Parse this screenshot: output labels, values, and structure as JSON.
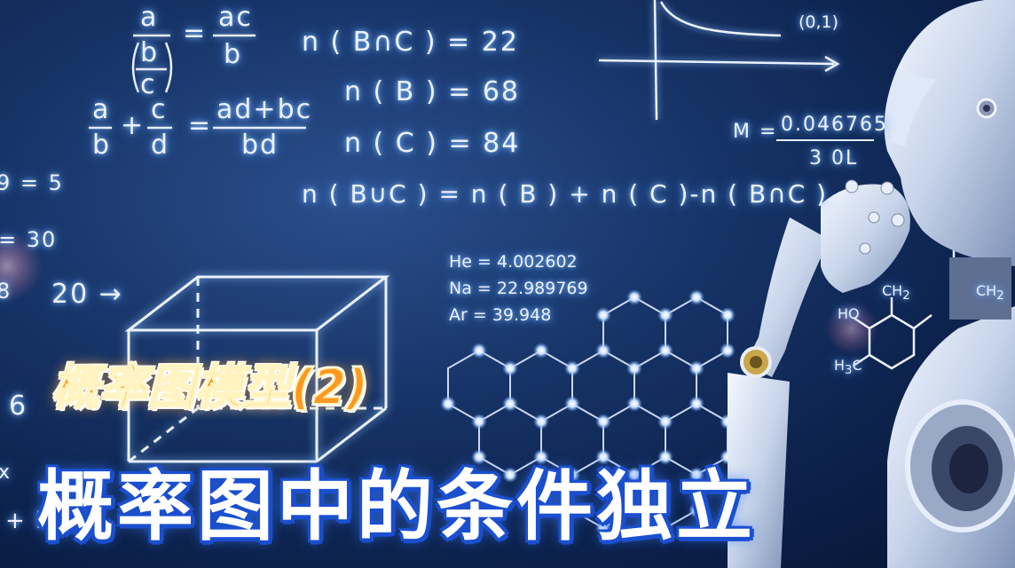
{
  "formulas": {
    "frac_nested_num": "a",
    "frac_nested_den_b": "b",
    "frac_nested_den_c": "c",
    "frac_eq": "=",
    "frac_result_num": "ac",
    "frac_result_den": "b",
    "add_a": "a",
    "add_b": "b",
    "add_plus": "+",
    "add_c": "c",
    "add_d": "d",
    "add_eq": "=",
    "add_result_num": "ad+bc",
    "add_result_den": "bd",
    "n_bc": "n ( B∩C ) = 22",
    "n_b": "n ( B ) = 68",
    "n_c": "n ( C ) = 84",
    "n_union": "n ( B∪C ) = n ( B ) + n ( C )-n ( B∩C )",
    "left_eq1": "9 = 5",
    "left_eq2": "= 30",
    "left_8": "8",
    "arrow_20": "20 →",
    "left_6": "6",
    "left_x": "x",
    "left_plus": "+ l",
    "m_eq": "M =",
    "m_num": "0.046765",
    "m_den": "3 0L",
    "point": "(0,1)",
    "he": "He = 4.002602",
    "na": "Na = 22.989769",
    "ar": "Ar = 39.948",
    "chem_ch2_a": "CH",
    "chem_ch2_b": "CH",
    "chem_ho": "HO",
    "chem_h3c": "H",
    "chem_sub2": "2",
    "chem_sub3": "3",
    "chem_c": "C"
  },
  "title": {
    "line1": "概率图模型(2)",
    "line2": "概率图中的条件独立"
  },
  "colors": {
    "title1_fill": "#ff9a1f",
    "title2_fill": "#ffffff",
    "title2_outline": "#1a4fd0",
    "glow": "#8fc0ff"
  }
}
